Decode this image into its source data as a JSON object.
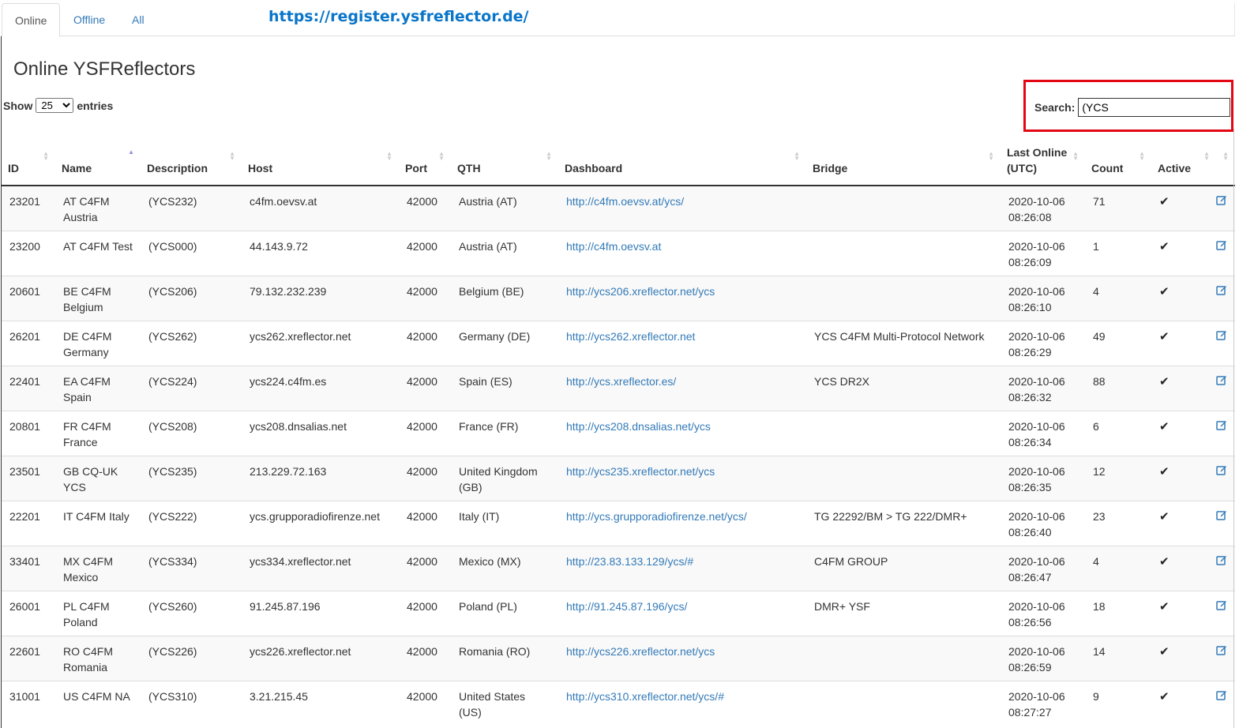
{
  "tabs": [
    {
      "label": "Online"
    },
    {
      "label": "Offline"
    },
    {
      "label": "All"
    }
  ],
  "url_overlay": "https://register.ysfreflector.de/",
  "page_title": "Online YSFReflectors",
  "length": {
    "show": "Show",
    "value": "25",
    "entries": "entries"
  },
  "search": {
    "label": "Search:",
    "value": "(YCS"
  },
  "columns": [
    "ID",
    "Name",
    "Description",
    "Host",
    "Port",
    "QTH",
    "Dashboard",
    "Bridge",
    "Last Online (UTC)",
    "Count",
    "Active",
    ""
  ],
  "rows": [
    {
      "id": "23201",
      "name": "AT C4FM Austria",
      "desc": "(YCS232)",
      "host": "c4fm.oevsv.at",
      "port": "42000",
      "qth": "Austria (AT)",
      "dashboard": "http://c4fm.oevsv.at/ycs/",
      "bridge": "",
      "last": "2020-10-06 08:26:08",
      "count": "71"
    },
    {
      "id": "23200",
      "name": "AT C4FM Test",
      "desc": "(YCS000)",
      "host": "44.143.9.72",
      "port": "42000",
      "qth": "Austria (AT)",
      "dashboard": "http://c4fm.oevsv.at",
      "bridge": "",
      "last": "2020-10-06 08:26:09",
      "count": "1"
    },
    {
      "id": "20601",
      "name": "BE C4FM Belgium",
      "desc": "(YCS206)",
      "host": "79.132.232.239",
      "port": "42000",
      "qth": "Belgium (BE)",
      "dashboard": "http://ycs206.xreflector.net/ycs",
      "bridge": "",
      "last": "2020-10-06 08:26:10",
      "count": "4"
    },
    {
      "id": "26201",
      "name": "DE C4FM Germany",
      "desc": "(YCS262)",
      "host": "ycs262.xreflector.net",
      "port": "42000",
      "qth": "Germany (DE)",
      "dashboard": "http://ycs262.xreflector.net",
      "bridge": "YCS C4FM Multi-Protocol Network",
      "last": "2020-10-06 08:26:29",
      "count": "49"
    },
    {
      "id": "22401",
      "name": "EA C4FM Spain",
      "desc": "(YCS224)",
      "host": "ycs224.c4fm.es",
      "port": "42000",
      "qth": "Spain (ES)",
      "dashboard": "http://ycs.xreflector.es/",
      "bridge": "YCS DR2X",
      "last": "2020-10-06 08:26:32",
      "count": "88"
    },
    {
      "id": "20801",
      "name": "FR C4FM France",
      "desc": "(YCS208)",
      "host": "ycs208.dnsalias.net",
      "port": "42000",
      "qth": "France (FR)",
      "dashboard": "http://ycs208.dnsalias.net/ycs",
      "bridge": "",
      "last": "2020-10-06 08:26:34",
      "count": "6"
    },
    {
      "id": "23501",
      "name": "GB CQ-UK YCS",
      "desc": "(YCS235)",
      "host": "213.229.72.163",
      "port": "42000",
      "qth": "United Kingdom (GB)",
      "dashboard": "http://ycs235.xreflector.net/ycs",
      "bridge": "",
      "last": "2020-10-06 08:26:35",
      "count": "12"
    },
    {
      "id": "22201",
      "name": "IT C4FM Italy",
      "desc": "(YCS222)",
      "host": "ycs.grupporadiofirenze.net",
      "port": "42000",
      "qth": "Italy (IT)",
      "dashboard": "http://ycs.grupporadiofirenze.net/ycs/",
      "bridge": "TG 22292/BM > TG 222/DMR+",
      "last": "2020-10-06 08:26:40",
      "count": "23"
    },
    {
      "id": "33401",
      "name": "MX C4FM Mexico",
      "desc": "(YCS334)",
      "host": "ycs334.xreflector.net",
      "port": "42000",
      "qth": "Mexico (MX)",
      "dashboard": "http://23.83.133.129/ycs/#",
      "bridge": "C4FM GROUP",
      "last": "2020-10-06 08:26:47",
      "count": "4"
    },
    {
      "id": "26001",
      "name": "PL C4FM Poland",
      "desc": "(YCS260)",
      "host": "91.245.87.196",
      "port": "42000",
      "qth": "Poland (PL)",
      "dashboard": "http://91.245.87.196/ycs/",
      "bridge": "DMR+ YSF",
      "last": "2020-10-06 08:26:56",
      "count": "18"
    },
    {
      "id": "22601",
      "name": "RO C4FM Romania",
      "desc": "(YCS226)",
      "host": "ycs226.xreflector.net",
      "port": "42000",
      "qth": "Romania (RO)",
      "dashboard": "http://ycs226.xreflector.net/ycs",
      "bridge": "",
      "last": "2020-10-06 08:26:59",
      "count": "14"
    },
    {
      "id": "31001",
      "name": "US C4FM NA",
      "desc": "(YCS310)",
      "host": "3.21.215.45",
      "port": "42000",
      "qth": "United States (US)",
      "dashboard": "http://ycs310.xreflector.net/ycs/#",
      "bridge": "",
      "last": "2020-10-06 08:27:27",
      "count": "9"
    }
  ],
  "icons": {
    "active": "check-icon",
    "edit": "edit-icon"
  },
  "colors": {
    "link": "#337ab7",
    "highlight_box": "#e30613",
    "url_overlay": "#0a75c9"
  }
}
